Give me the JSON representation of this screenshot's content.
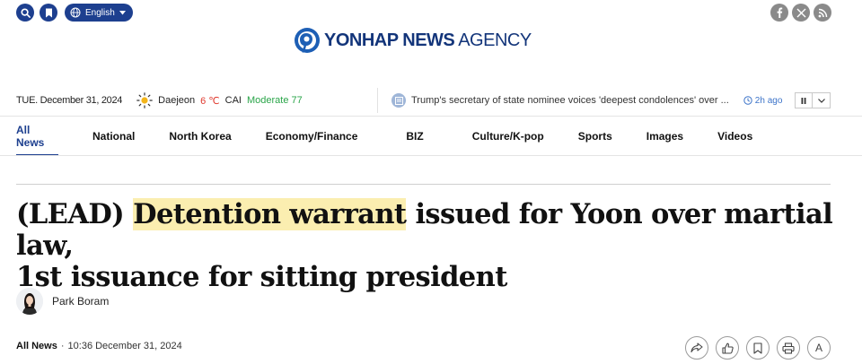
{
  "topbar": {
    "language": "English",
    "colors": {
      "brand": "#1d3f8f",
      "social": "#8a8a8a"
    }
  },
  "logo": {
    "brand": "YONHAP NEWS",
    "suffix": "AGENCY"
  },
  "info": {
    "date": "TUE. December 31, 2024",
    "city": "Daejeon",
    "temperature": "6 ℃",
    "cai_label": "CAI",
    "cai_value": "Moderate 77",
    "ticker_text": "Trump's secretary of state nominee voices 'deepest condolences' over ...",
    "ticker_time": "2h ago"
  },
  "nav": {
    "items": [
      {
        "label": "All News"
      },
      {
        "label": "National"
      },
      {
        "label": "North Korea"
      },
      {
        "label": "Economy/Finance"
      },
      {
        "label": "BIZ"
      },
      {
        "label": "Culture/K-pop"
      },
      {
        "label": "Sports"
      },
      {
        "label": "Images"
      },
      {
        "label": "Videos"
      }
    ]
  },
  "article": {
    "headline_prefix": "(LEAD) ",
    "headline_highlight": "Detention warrant",
    "headline_line1_rest": " issued for Yoon over martial law,",
    "headline_line2": "1st issuance for sitting president",
    "author": "Park Boram",
    "section": "All News",
    "separator": "·",
    "timestamp": "10:36 December 31, 2024",
    "font_size_label": "A"
  },
  "icons": {
    "search": "search-icon",
    "bookmark": "bookmark-icon",
    "globe": "globe-icon",
    "facebook": "facebook-icon",
    "x": "x-icon",
    "rss": "rss-icon",
    "sun": "sun-icon",
    "share": "share-icon",
    "like": "thumbs-up-icon",
    "save": "bookmark-icon",
    "print": "print-icon"
  }
}
